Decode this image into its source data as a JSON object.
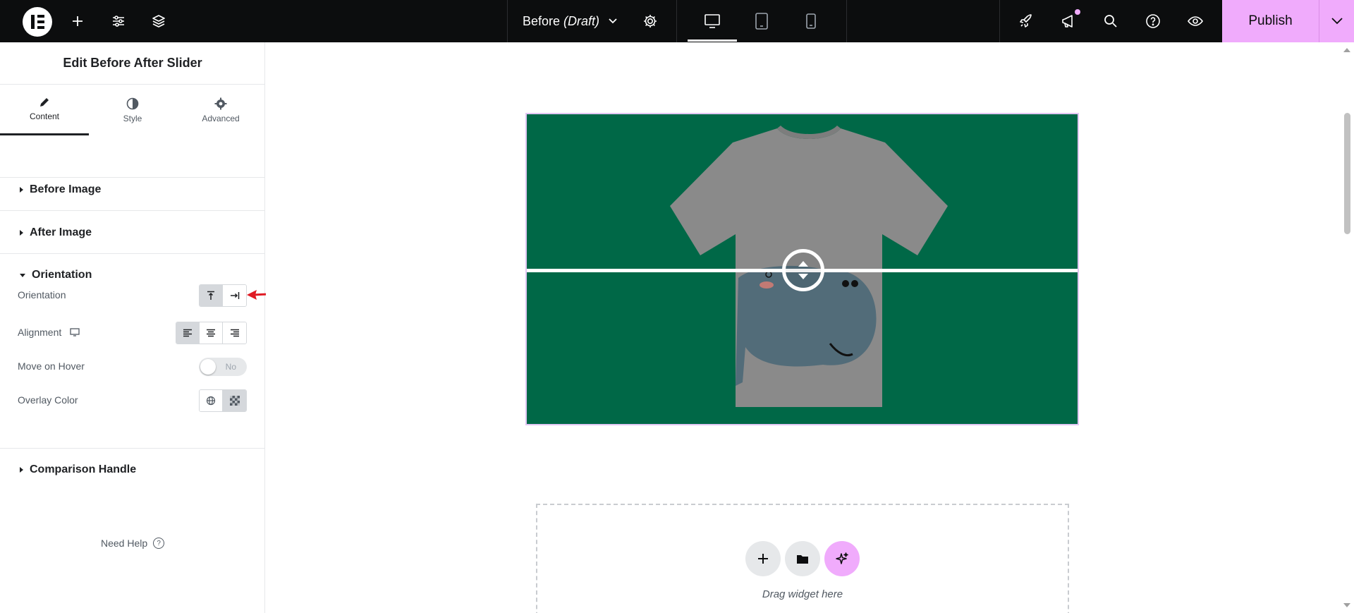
{
  "topbar": {
    "doc_name": "Before",
    "doc_status": "(Draft)",
    "publish_label": "Publish"
  },
  "panel": {
    "title": "Edit Before After Slider",
    "tabs": [
      {
        "label": "Content",
        "icon": "pencil-icon",
        "active": true
      },
      {
        "label": "Style",
        "icon": "contrast-icon",
        "active": false
      },
      {
        "label": "Advanced",
        "icon": "gear-icon",
        "active": false
      }
    ],
    "sections": {
      "before_image": "Before Image",
      "after_image": "After Image",
      "orientation": "Orientation",
      "comparison_handle": "Comparison Handle"
    },
    "controls": {
      "orientation_label": "Orientation",
      "alignment_label": "Alignment",
      "move_on_hover_label": "Move on Hover",
      "move_on_hover_value": "No",
      "overlay_color_label": "Overlay Color"
    },
    "need_help": "Need Help",
    "need_help_icon": "?"
  },
  "canvas": {
    "drag_widget_text": "Drag widget here"
  },
  "colors": {
    "accent": "#f0abfc",
    "slider_bg": "#006847",
    "topbar_bg": "#0c0d0e"
  }
}
